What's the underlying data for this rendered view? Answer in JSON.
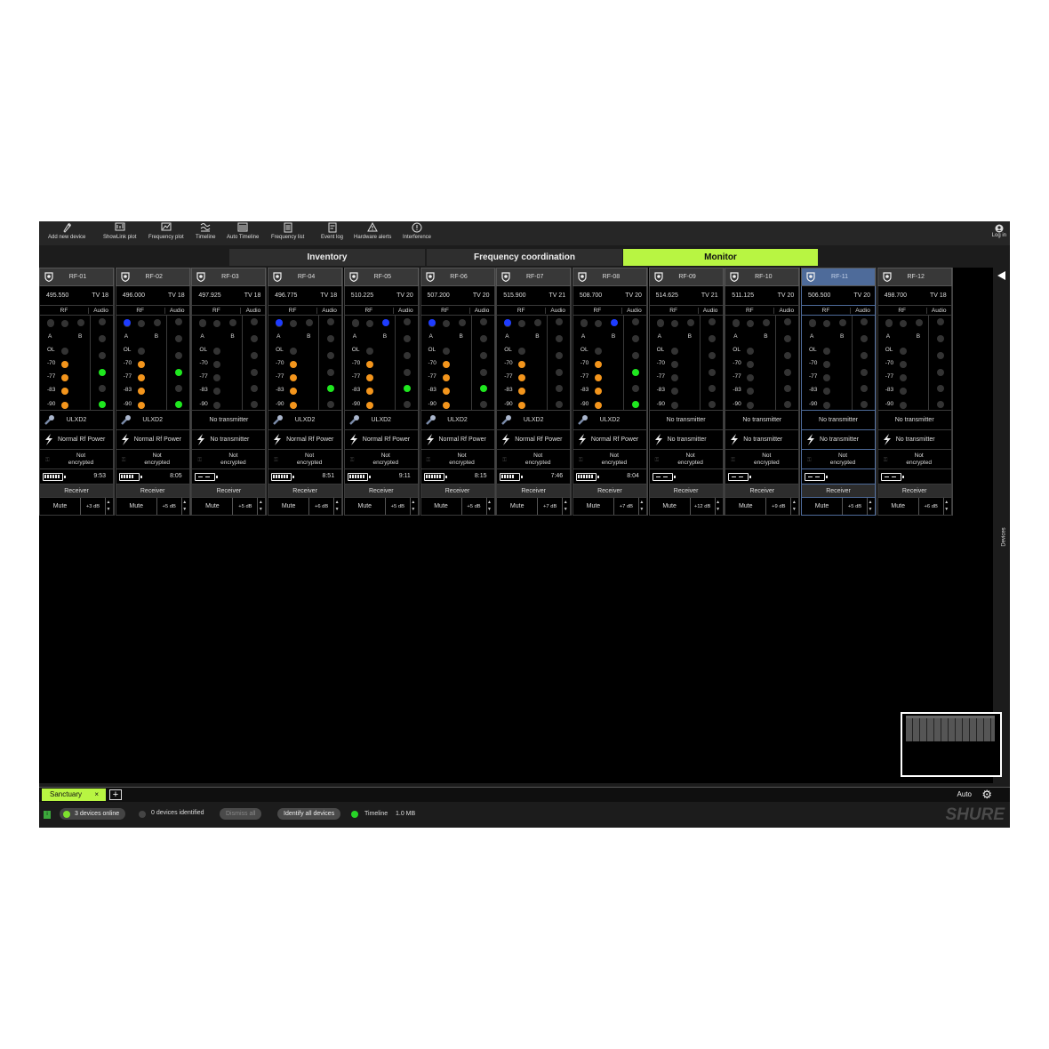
{
  "toolbar": {
    "items": [
      {
        "label": "Add new device",
        "icon": "add-device-icon"
      },
      {
        "label": "ShowLink plot",
        "icon": "showlink-plot-icon"
      },
      {
        "label": "Frequency plot",
        "icon": "frequency-plot-icon"
      },
      {
        "label": "Timeline",
        "icon": "timeline-icon"
      },
      {
        "label": "Auto Timeline",
        "icon": "auto-timeline-icon"
      },
      {
        "label": "Frequency list",
        "icon": "frequency-list-icon"
      },
      {
        "label": "Event log",
        "icon": "event-log-icon"
      },
      {
        "label": "Hardware alerts",
        "icon": "warning-icon"
      },
      {
        "label": "Interference",
        "icon": "info-icon"
      }
    ],
    "login": "Log in"
  },
  "tabs": [
    {
      "label": "Inventory",
      "active": false
    },
    {
      "label": "Frequency coordination",
      "active": false
    },
    {
      "label": "Monitor",
      "active": true
    }
  ],
  "meter_labels": {
    "rf": "RF",
    "audio": "Audio",
    "a": "A",
    "b": "B",
    "levels": [
      "OL",
      "-70",
      "-77",
      "-83",
      "-90"
    ]
  },
  "receiver_label": "Receiver",
  "mute_label": "Mute",
  "encryption_label": "Not encrypted",
  "channels": [
    {
      "name": "RF-01",
      "freq": "495.550",
      "tv": "TV 18",
      "tx": "ULXD2",
      "power": "Normal Rf Power",
      "battery": "full",
      "time": "9:53",
      "gain": "+3 dB",
      "antenna": "",
      "rf_level": 4,
      "audio_level": 2,
      "selected": false
    },
    {
      "name": "RF-02",
      "freq": "496.000",
      "tv": "TV 18",
      "tx": "ULXD2",
      "power": "Normal Rf Power",
      "battery": "partial",
      "time": "8:05",
      "gain": "+5 dB",
      "antenna": "A",
      "rf_level": 4,
      "audio_level": 2,
      "selected": false
    },
    {
      "name": "RF-03",
      "freq": "497.925",
      "tv": "TV 18",
      "tx": "No transmitter",
      "power": "No transmitter",
      "battery": "empty",
      "time": "",
      "gain": "+5 dB",
      "antenna": "",
      "rf_level": 0,
      "audio_level": 0,
      "selected": false
    },
    {
      "name": "RF-04",
      "freq": "496.775",
      "tv": "TV 18",
      "tx": "ULXD2",
      "power": "Normal Rf Power",
      "battery": "full",
      "time": "8:51",
      "gain": "+6 dB",
      "antenna": "A",
      "rf_level": 4,
      "audio_level": 1,
      "selected": false
    },
    {
      "name": "RF-05",
      "freq": "510.225",
      "tv": "TV 20",
      "tx": "ULXD2",
      "power": "Normal Rf Power",
      "battery": "full",
      "time": "9:11",
      "gain": "+5 dB",
      "antenna": "B",
      "rf_level": 4,
      "audio_level": 1,
      "selected": false
    },
    {
      "name": "RF-06",
      "freq": "507.200",
      "tv": "TV 20",
      "tx": "ULXD2",
      "power": "Normal Rf Power",
      "battery": "full",
      "time": "8:15",
      "gain": "+5 dB",
      "antenna": "A",
      "rf_level": 4,
      "audio_level": 1,
      "selected": false
    },
    {
      "name": "RF-07",
      "freq": "515.900",
      "tv": "TV 21",
      "tx": "ULXD2",
      "power": "Normal Rf Power",
      "battery": "partial",
      "time": "7:46",
      "gain": "+7 dB",
      "antenna": "A",
      "rf_level": 4,
      "audio_level": 0,
      "selected": false
    },
    {
      "name": "RF-08",
      "freq": "508.700",
      "tv": "TV 20",
      "tx": "ULXD2",
      "power": "Normal Rf Power",
      "battery": "full",
      "time": "8:04",
      "gain": "+7 dB",
      "antenna": "B",
      "rf_level": 4,
      "audio_level": 2,
      "selected": false
    },
    {
      "name": "RF-09",
      "freq": "514.625",
      "tv": "TV 21",
      "tx": "No transmitter",
      "power": "No transmitter",
      "battery": "empty",
      "time": "",
      "gain": "+12 dB",
      "antenna": "",
      "rf_level": 0,
      "audio_level": 0,
      "selected": false
    },
    {
      "name": "RF-10",
      "freq": "511.125",
      "tv": "TV 20",
      "tx": "No transmitter",
      "power": "No transmitter",
      "battery": "empty",
      "time": "",
      "gain": "+9 dB",
      "antenna": "",
      "rf_level": 0,
      "audio_level": 0,
      "selected": false
    },
    {
      "name": "RF-11",
      "freq": "506.500",
      "tv": "TV 20",
      "tx": "No transmitter",
      "power": "No transmitter",
      "battery": "empty",
      "time": "",
      "gain": "+5 dB",
      "antenna": "",
      "rf_level": 0,
      "audio_level": 0,
      "selected": true
    },
    {
      "name": "RF-12",
      "freq": "498.700",
      "tv": "TV 18",
      "tx": "No transmitter",
      "power": "No transmitter",
      "battery": "empty",
      "time": "",
      "gain": "+6 dB",
      "antenna": "",
      "rf_level": 0,
      "audio_level": 0,
      "selected": false
    }
  ],
  "devices_panel": "Devices",
  "venue_tab": {
    "label": "Sanctuary",
    "close": "×",
    "add": "+"
  },
  "auto_label": "Auto",
  "status": {
    "devices_online": "3 devices online",
    "devices_identified": "0 devices identified",
    "dismiss_all": "Dismiss all",
    "identify_all": "Identify all devices",
    "timeline": "Timeline",
    "timeline_size": "1.0 MB"
  },
  "brand": "SHURE",
  "colors": {
    "accent": "#b8f542",
    "online": "#7ee02e",
    "meter_orange": "#f3951c",
    "meter_green": "#1fe71f",
    "antenna_blue": "#1e3cff",
    "selected": "#4e6b9a"
  }
}
